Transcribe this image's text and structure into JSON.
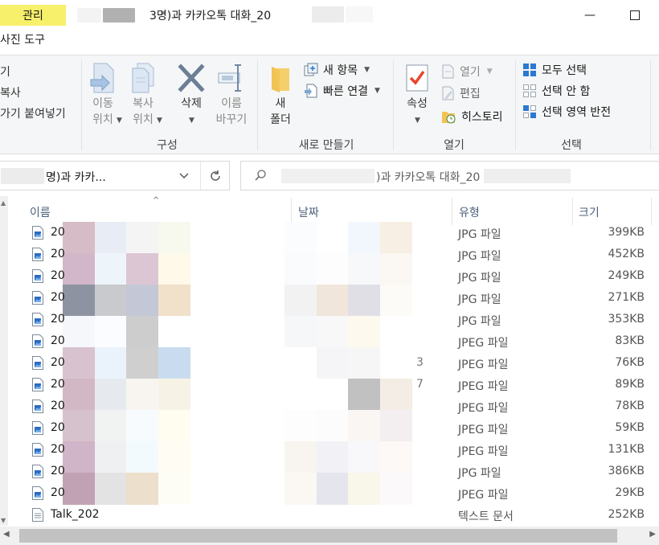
{
  "titlebar": {
    "context_tab": "관리",
    "window_title": "3명)과 카카오톡 대화_20",
    "minimize": "—",
    "maximize": "☐"
  },
  "ribbon_tabs": {
    "photo_tools": "사진 도구"
  },
  "ribbon": {
    "clipboard_partial": [
      "기",
      "복사",
      "가기 붙여넣기"
    ],
    "organize": {
      "move_to": "이동\n위치",
      "copy_to": "복사\n위치",
      "delete": "삭제",
      "rename": "이름\n바꾸기",
      "label": "구성"
    },
    "new": {
      "new_folder": "새\n폴더",
      "new_item": "새 항목",
      "easy_access": "빠른 연결",
      "label": "새로 만들기"
    },
    "open": {
      "properties": "속성",
      "open": "열기",
      "edit": "편집",
      "history": "히스토리",
      "label": "열기"
    },
    "select": {
      "select_all": "모두 선택",
      "select_none": "선택 안 함",
      "invert": "선택 영역 반전",
      "label": "선택"
    }
  },
  "address": {
    "path": "명)과 카카...",
    "search_placeholder": ")과 카카오톡 대화_20          8 검색"
  },
  "columns": {
    "name": "이름",
    "date": "날짜",
    "type": "유형",
    "size": "크기"
  },
  "files": [
    {
      "name": "20",
      "type": "JPG 파일",
      "size": "399KB",
      "frag": ""
    },
    {
      "name": "20",
      "type": "JPG 파일",
      "size": "452KB",
      "frag": ""
    },
    {
      "name": "20",
      "type": "JPG 파일",
      "size": "249KB",
      "frag": ""
    },
    {
      "name": "20",
      "type": "JPG 파일",
      "size": "271KB",
      "frag": ""
    },
    {
      "name": "20",
      "type": "JPG 파일",
      "size": "353KB",
      "frag": ""
    },
    {
      "name": "20",
      "type": "JPEG 파일",
      "size": "83KB",
      "frag": ""
    },
    {
      "name": "20",
      "type": "JPEG 파일",
      "size": "76KB",
      "frag": "3"
    },
    {
      "name": "20",
      "type": "JPEG 파일",
      "size": "89KB",
      "frag": "7"
    },
    {
      "name": "20",
      "type": "JPEG 파일",
      "size": "78KB",
      "frag": ""
    },
    {
      "name": "20",
      "type": "JPEG 파일",
      "size": "59KB",
      "frag": ""
    },
    {
      "name": "20",
      "type": "JPEG 파일",
      "size": "131KB",
      "frag": ""
    },
    {
      "name": "20",
      "type": "JPG 파일",
      "size": "386KB",
      "frag": ""
    },
    {
      "name": "20",
      "type": "JPEG 파일",
      "size": "29KB",
      "frag": ""
    },
    {
      "name": "Talk_202",
      "type": "텍스트 문서",
      "size": "252KB",
      "frag": ""
    }
  ],
  "colors": {
    "context_tab_bg": "#f7f06a",
    "ribbon_bg": "#f5f6f7",
    "header_text": "#4c607a",
    "accent": "#2b79d0"
  }
}
